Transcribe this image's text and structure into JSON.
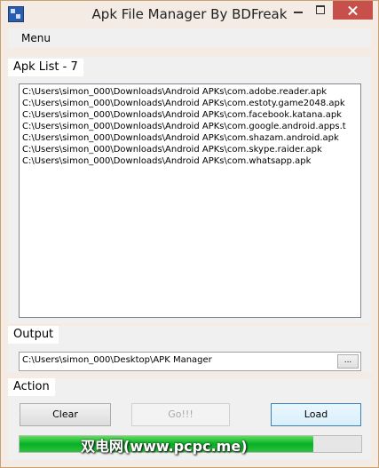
{
  "window": {
    "title": "Apk File Manager By BDFreak"
  },
  "menu": {
    "items": [
      "Menu"
    ]
  },
  "apk_list": {
    "label": "Apk List - 7",
    "items": [
      "C:\\Users\\simon_000\\Downloads\\Android APKs\\com.adobe.reader.apk",
      "C:\\Users\\simon_000\\Downloads\\Android APKs\\com.estoty.game2048.apk",
      "C:\\Users\\simon_000\\Downloads\\Android APKs\\com.facebook.katana.apk",
      "C:\\Users\\simon_000\\Downloads\\Android APKs\\com.google.android.apps.t",
      "C:\\Users\\simon_000\\Downloads\\Android APKs\\com.shazam.android.apk",
      "C:\\Users\\simon_000\\Downloads\\Android APKs\\com.skype.raider.apk",
      "C:\\Users\\simon_000\\Downloads\\Android APKs\\com.whatsapp.apk"
    ]
  },
  "output": {
    "label": "Output",
    "path": "C:\\Users\\simon_000\\Desktop\\APK Manager",
    "browse_label": "..."
  },
  "action": {
    "label": "Action",
    "clear_label": "Clear",
    "go_label": "Go!!!",
    "load_label": "Load",
    "progress_fraction": 0.86
  },
  "watermark": "双电网(www.pcpc.me)",
  "colors": {
    "progress_fill": "#06b025",
    "close_button": "#c7504a"
  }
}
